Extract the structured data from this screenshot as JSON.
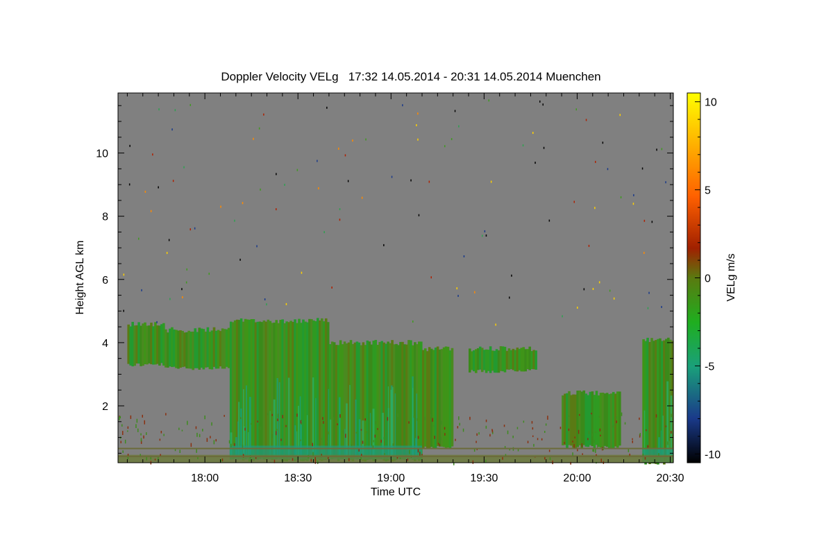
{
  "chart_data": {
    "type": "heatmap",
    "title": "Doppler Velocity VELg   17:32 14.05.2014 - 20:31 14.05.2014 Muenchen",
    "xlabel": "Time UTC",
    "ylabel": "Height AGL km",
    "xlim": [
      "17:32",
      "20:31"
    ],
    "ylim": [
      0.2,
      11.9
    ],
    "x_ticks": [
      "18:00",
      "18:30",
      "19:00",
      "19:30",
      "20:00",
      "20:30"
    ],
    "y_ticks": [
      2,
      4,
      6,
      8,
      10
    ],
    "colorbar": {
      "label": "VELg m/s",
      "range": [
        -10.5,
        10.5
      ],
      "ticks": [
        -10,
        -5,
        0,
        5,
        10
      ],
      "colors": [
        "#000000",
        "#1a3a8a",
        "#1aa07a",
        "#1fae1f",
        "#5a7a10",
        "#a02000",
        "#ff6000",
        "#ffb000",
        "#ffff00"
      ]
    },
    "background_color": "#808080",
    "cloud_regions": [
      {
        "start": "17:35",
        "end": "17:47",
        "base_km": 3.3,
        "top_km": 4.6
      },
      {
        "start": "17:47",
        "end": "18:08",
        "base_km": 3.2,
        "top_km": 4.4
      },
      {
        "start": "18:08",
        "end": "18:40",
        "base_km": 0.3,
        "top_km": 4.7
      },
      {
        "start": "18:40",
        "end": "19:10",
        "base_km": 0.3,
        "top_km": 4.0
      },
      {
        "start": "19:10",
        "end": "19:20",
        "base_km": 0.7,
        "top_km": 3.8
      },
      {
        "start": "19:25",
        "end": "19:47",
        "base_km": 3.1,
        "top_km": 3.8
      },
      {
        "start": "19:55",
        "end": "20:14",
        "base_km": 0.7,
        "top_km": 2.4
      },
      {
        "start": "20:21",
        "end": "20:31",
        "base_km": 0.2,
        "top_km": 4.1
      }
    ]
  }
}
